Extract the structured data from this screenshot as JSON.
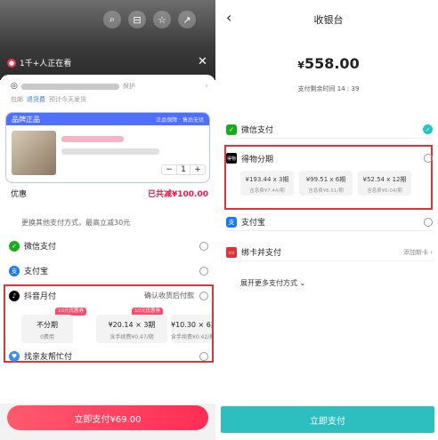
{
  "left": {
    "viewers": "1千+人正在看",
    "address_prefix": "保护",
    "address_sub": {
      "pkg": "包邮",
      "fee": "退货费",
      "ship": "预计今天发货"
    },
    "brand": {
      "title": "品牌正品",
      "right": "正品保障 · 售后无忧"
    },
    "quantity": "1",
    "discount": {
      "label": "优惠",
      "amount": "已共减¥100.00"
    },
    "other_pay": "更换其他支付方式，最高立减30元",
    "methods": [
      {
        "name": "微信支付",
        "color": "#1aad19",
        "icon": "wechat-icon"
      },
      {
        "name": "支付宝",
        "color": "#1677ff",
        "icon": "alipay-icon"
      },
      {
        "name": "抖音月付",
        "color": "#000000",
        "icon": "douyin-icon",
        "note": "确认收货后付款"
      },
      {
        "name": "找亲友帮忙付",
        "color": "#3a8ee6",
        "icon": "friend-icon"
      }
    ],
    "plans": [
      {
        "title": "不分期",
        "sub": "0费用"
      },
      {
        "title": "¥20.14 × 3期",
        "sub": "含手续费¥0.47/期",
        "tag": "10元优惠券"
      },
      {
        "title": "¥10.30 × 6期",
        "sub": "含手续费¥0.42/期",
        "tag": "10元优惠券"
      }
    ],
    "first_tag": "10元优惠券",
    "pay_button": "立即支付¥69.00"
  },
  "right": {
    "title": "收银台",
    "amount": "558.00",
    "currency": "¥",
    "remain": "支付剩余时间 14 : 39",
    "methods": [
      {
        "name": "微信支付",
        "color": "#1aad19",
        "icon": "wechat-icon",
        "selected": true
      },
      {
        "name": "得物分期",
        "color": "#000000",
        "icon": "dewu-icon"
      },
      {
        "name": "支付宝",
        "color": "#1677ff",
        "icon": "alipay-icon"
      },
      {
        "name": "绑卡并支付",
        "color": "#e0323c",
        "icon": "card-icon",
        "extra": "添加新卡 ›"
      }
    ],
    "installments": [
      {
        "title": "¥193.44 x 3期",
        "sub": "含息费¥7.44/期"
      },
      {
        "title": "¥99.51 x 6期",
        "sub": "含息费¥6.51/期"
      },
      {
        "title": "¥52.54 x 12期",
        "sub": "含息费¥6.04/期"
      }
    ],
    "expand": "展开更多支付方式 ⌄",
    "pay_button": "立即支付"
  }
}
